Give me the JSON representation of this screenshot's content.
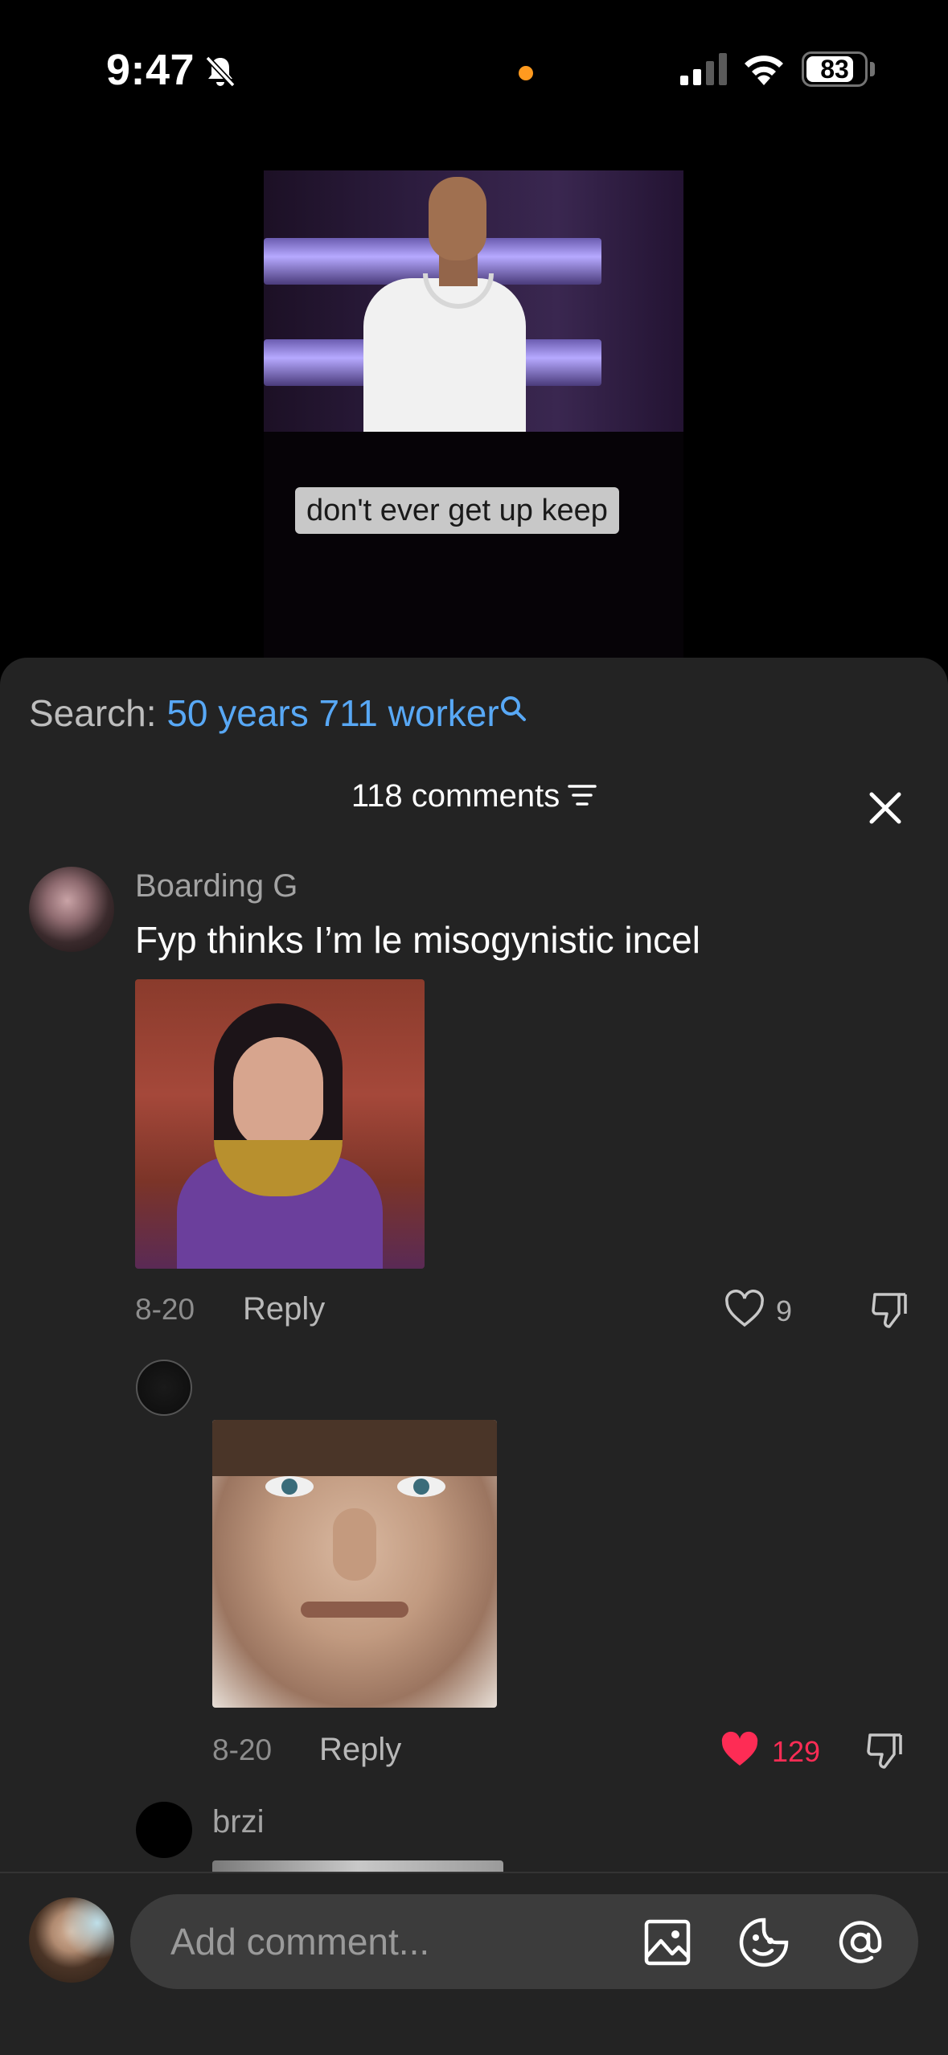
{
  "status_bar": {
    "time": "9:47",
    "battery": "83",
    "battery_level": 0.83
  },
  "video": {
    "caption": "don't ever get up keep"
  },
  "search": {
    "prefix": "Search: ",
    "term": "50 years 711 worker"
  },
  "comments_header": {
    "count_label": "118 comments"
  },
  "comments": [
    {
      "username": "Boarding G",
      "text": "Fyp thinks I’m le misogynistic incel",
      "date": "8-20",
      "reply_label": "Reply",
      "likes": "9",
      "liked": false
    },
    {
      "username": "",
      "text": "",
      "date": "8-20",
      "reply_label": "Reply",
      "likes": "129",
      "liked": true
    },
    {
      "username": "brzi"
    }
  ],
  "composer": {
    "placeholder": "Add comment..."
  },
  "colors": {
    "accent_blue": "#58a8f5",
    "like_red": "#fe2c55",
    "sheet_bg": "#232323"
  },
  "icons": [
    "bell-off-icon",
    "signal-icon",
    "wifi-icon",
    "battery-icon",
    "search-icon",
    "filter-icon",
    "close-icon",
    "heart-icon",
    "dislike-icon",
    "image-icon",
    "emoji-icon",
    "at-icon"
  ]
}
